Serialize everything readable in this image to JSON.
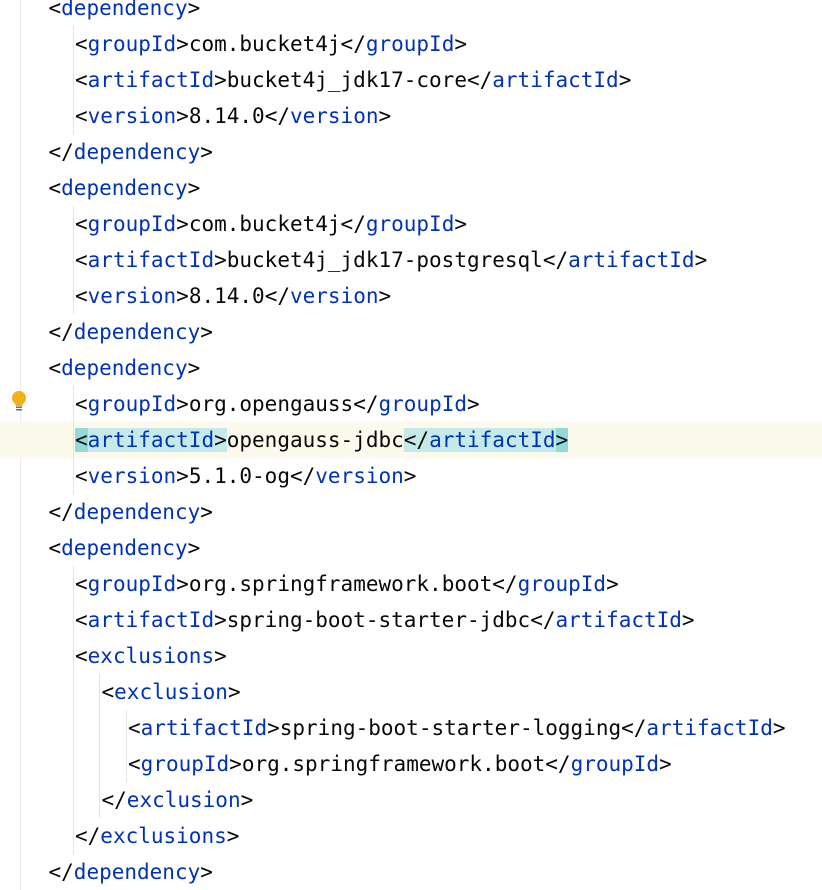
{
  "editor": {
    "lines": [
      {
        "i": 1,
        "t": "dependency",
        "open": true
      },
      {
        "i": 2,
        "t": "groupId",
        "v": "com.bucket4j"
      },
      {
        "i": 2,
        "t": "artifactId",
        "v": "bucket4j_jdk17-core"
      },
      {
        "i": 2,
        "t": "version",
        "v": "8.14.0"
      },
      {
        "i": 1,
        "t": "dependency",
        "close": true
      },
      {
        "i": 1,
        "t": "dependency",
        "open": true
      },
      {
        "i": 2,
        "t": "groupId",
        "v": "com.bucket4j"
      },
      {
        "i": 2,
        "t": "artifactId",
        "v": "bucket4j_jdk17-postgresql"
      },
      {
        "i": 2,
        "t": "version",
        "v": "8.14.0"
      },
      {
        "i": 1,
        "t": "dependency",
        "close": true
      },
      {
        "i": 1,
        "t": "dependency",
        "open": true
      },
      {
        "i": 2,
        "t": "groupId",
        "v": "org.opengauss"
      },
      {
        "i": 2,
        "t": "artifactId",
        "v": "opengauss-jdbc",
        "highlight": true
      },
      {
        "i": 2,
        "t": "version",
        "v": "5.1.0-og"
      },
      {
        "i": 1,
        "t": "dependency",
        "close": true
      },
      {
        "i": 1,
        "t": "dependency",
        "open": true
      },
      {
        "i": 2,
        "t": "groupId",
        "v": "org.springframework.boot"
      },
      {
        "i": 2,
        "t": "artifactId",
        "v": "spring-boot-starter-jdbc"
      },
      {
        "i": 2,
        "t": "exclusions",
        "open": true
      },
      {
        "i": 3,
        "t": "exclusion",
        "open": true
      },
      {
        "i": 4,
        "t": "artifactId",
        "v": "spring-boot-starter-logging"
      },
      {
        "i": 4,
        "t": "groupId",
        "v": "org.springframework.boot"
      },
      {
        "i": 3,
        "t": "exclusion",
        "close": true
      },
      {
        "i": 2,
        "t": "exclusions",
        "close": true
      },
      {
        "i": 1,
        "t": "dependency",
        "close": true
      }
    ],
    "current_line_index": 12,
    "intention_icon": "lightbulb-icon",
    "colors": {
      "tag": "#0033b3",
      "text": "#080808",
      "tag_highlight": "#c5eae9",
      "bracket_highlight": "#93d9d9",
      "caret_row": "#fcfaed"
    }
  }
}
